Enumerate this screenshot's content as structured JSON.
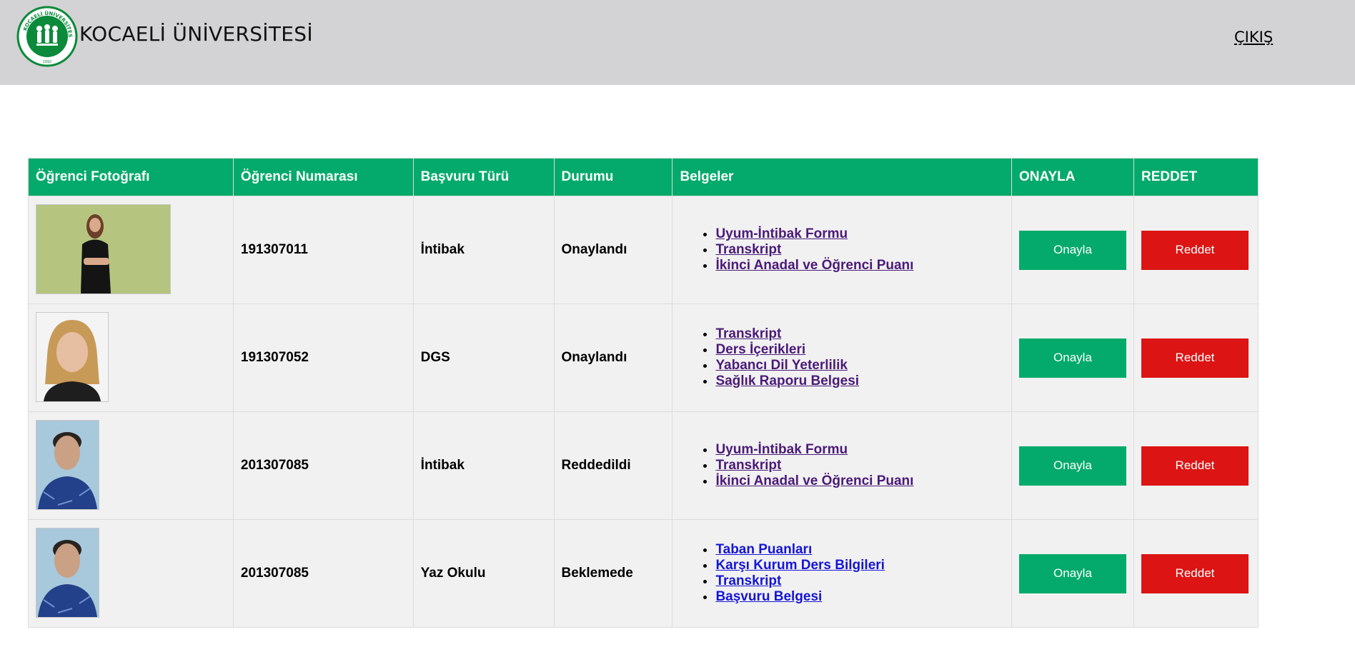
{
  "header": {
    "brand": "KOCAELİ ÜNİVERSİTESİ",
    "logo_ring_text": "KOCAELİ ÜNİVERSİTESİ",
    "logo_year": "1992",
    "logout_label": "ÇIKIŞ",
    "colors": {
      "background": "#d3d2d4",
      "logo_green": "#0a8a3a"
    }
  },
  "table": {
    "columns": [
      "Öğrenci Fotoğrafı",
      "Öğrenci Numarası",
      "Başvuru Türü",
      "Durumu",
      "Belgeler",
      "ONAYLA",
      "REDDET"
    ],
    "header_color": "#03aa6b",
    "approve_color": "#03aa6b",
    "reject_color": "#dc1414",
    "rows": [
      {
        "photo": "student-photo",
        "student_no": "191307011",
        "type": "İntibak",
        "status": "Onaylandı",
        "documents": [
          "Uyum-İntibak Formu",
          "Transkript",
          "İkinci Anadal ve Öğrenci Puanı"
        ],
        "approve_label": "Onayla",
        "reject_label": "Reddet"
      },
      {
        "photo": "student-photo",
        "student_no": "191307052",
        "type": "DGS",
        "status": "Onaylandı",
        "documents": [
          "Transkript",
          "Ders İçerikleri",
          "Yabancı Dil Yeterlilik",
          "Sağlık Raporu Belgesi"
        ],
        "approve_label": "Onayla",
        "reject_label": "Reddet"
      },
      {
        "photo": "student-photo",
        "student_no": "201307085",
        "type": "İntibak",
        "status": "Reddedildi",
        "documents": [
          "Uyum-İntibak Formu",
          "Transkript",
          "İkinci Anadal ve Öğrenci Puanı"
        ],
        "approve_label": "Onayla",
        "reject_label": "Reddet"
      },
      {
        "photo": "student-photo",
        "student_no": "201307085",
        "type": "Yaz Okulu",
        "status": "Beklemede",
        "documents": [
          "Taban Puanları",
          "Karşı Kurum Ders Bilgileri",
          "Transkript",
          "Başvuru Belgesi"
        ],
        "approve_label": "Onayla",
        "reject_label": "Reddet"
      }
    ]
  }
}
